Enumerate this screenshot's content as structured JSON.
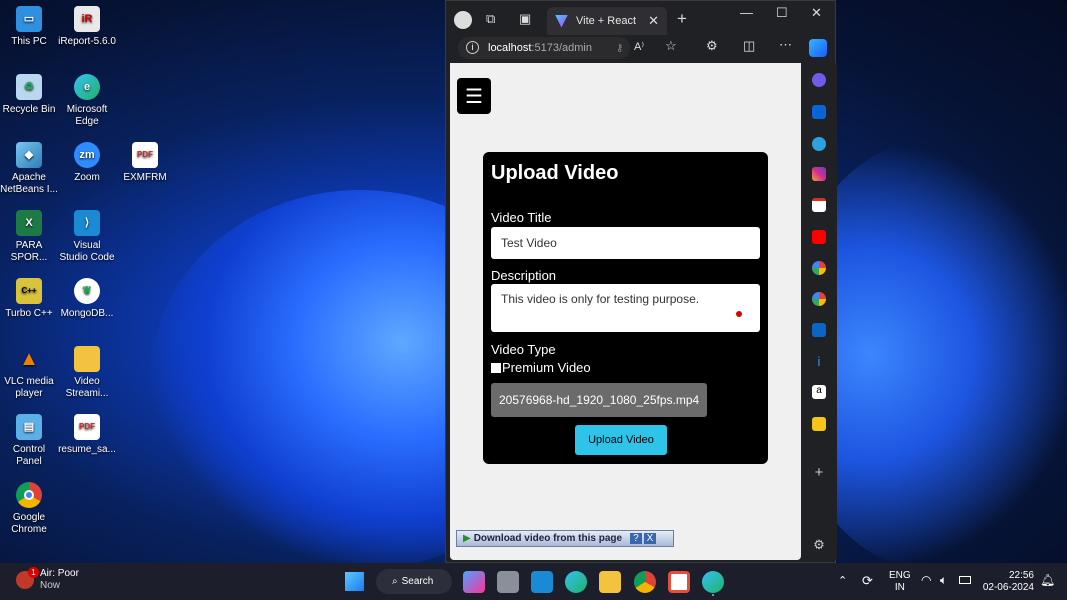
{
  "desktop_icons": [
    {
      "label": "This PC",
      "icon": "computer-icon"
    },
    {
      "label": "iReport-5.6.0",
      "icon": "ireport-icon"
    },
    {
      "label": "Recycle Bin",
      "icon": "recycle-bin-icon"
    },
    {
      "label": "Microsoft Edge",
      "icon": "edge-icon"
    },
    {
      "label": "Apache NetBeans I...",
      "icon": "netbeans-icon"
    },
    {
      "label": "Zoom",
      "icon": "zoom-icon"
    },
    {
      "label": "EXMFRM",
      "icon": "pdf-icon"
    },
    {
      "label": "PARA SPOR...",
      "icon": "excel-icon"
    },
    {
      "label": "Visual Studio Code",
      "icon": "vscode-icon"
    },
    {
      "label": "Turbo C++",
      "icon": "turbo-cpp-icon"
    },
    {
      "label": "MongoDB...",
      "icon": "mongodb-icon"
    },
    {
      "label": "VLC media player",
      "icon": "vlc-icon"
    },
    {
      "label": "Video Streami...",
      "icon": "folder-icon"
    },
    {
      "label": "Control Panel",
      "icon": "control-panel-icon"
    },
    {
      "label": "resume_sa...",
      "icon": "pdf-icon"
    },
    {
      "label": "Google Chrome",
      "icon": "chrome-icon"
    }
  ],
  "browser": {
    "tab_title": "Vite + React",
    "url_host": "localhost",
    "url_rest": ":5173/admin"
  },
  "page": {
    "heading": "Upload Video",
    "video_title_label": "Video Title",
    "video_title_value": "Test Video",
    "description_label": "Description",
    "description_value": "This video is only for testing purpose.",
    "video_type_label": "Video Type",
    "premium_label": "Premium Video",
    "file_name": "20576968-hd_1920_1080_25fps.mp4",
    "upload_button": "Upload Video",
    "download_bar": "Download video from this page",
    "download_help": "?",
    "download_close": "X"
  },
  "taskbar": {
    "weather_title": "Air: Poor",
    "weather_sub": "Now",
    "weather_badge": "1",
    "search_label": "Search",
    "lang_1": "ENG",
    "lang_2": "IN",
    "time": "22:56",
    "date": "02-06-2024"
  }
}
